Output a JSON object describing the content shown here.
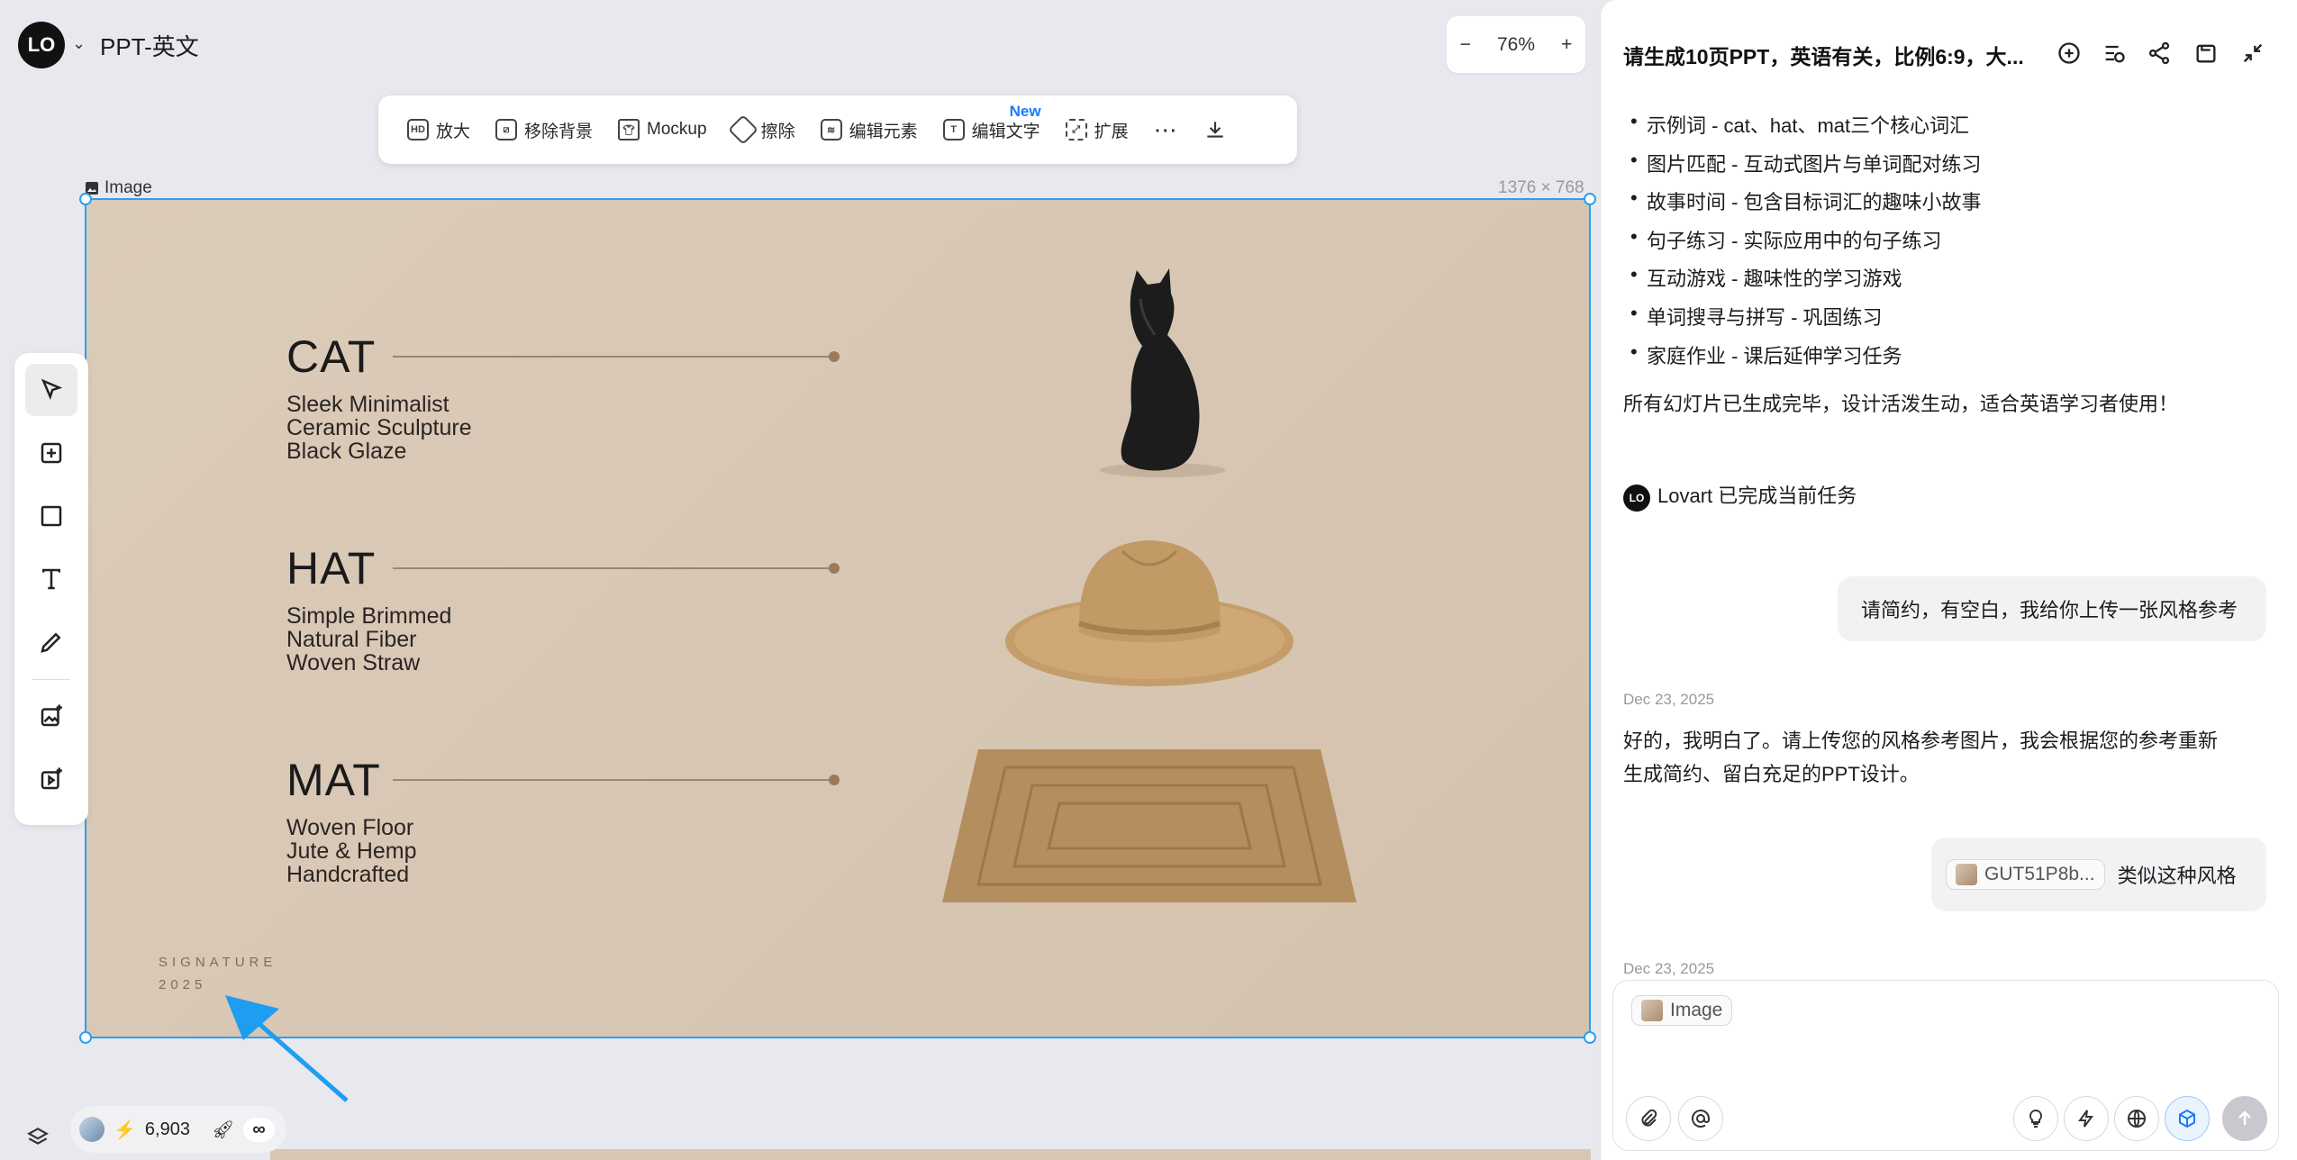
{
  "app": {
    "project_title": "PPT-英文",
    "logo_text": "LO",
    "zoom": "76%"
  },
  "toolbar": {
    "items": [
      {
        "label": "放大",
        "icon": "hd-icon"
      },
      {
        "label": "移除背景",
        "icon": "remove-bg-icon"
      },
      {
        "label": "Mockup",
        "icon": "shirt-icon"
      },
      {
        "label": "擦除",
        "icon": "eraser-icon"
      },
      {
        "label": "编辑元素",
        "icon": "layers-edit-icon"
      },
      {
        "label": "编辑文字",
        "icon": "text-edit-icon",
        "badge": "New"
      },
      {
        "label": "扩展",
        "icon": "expand-icon"
      }
    ]
  },
  "canvas": {
    "image_label": "Image",
    "image_size": "1376 × 768",
    "slide": {
      "rows": [
        {
          "word": "CAT",
          "lines": [
            "Sleek Minimalist",
            "Ceramic Sculpture",
            "Black Glaze"
          ]
        },
        {
          "word": "HAT",
          "lines": [
            "Simple Brimmed",
            "Natural Fiber",
            "Woven Straw"
          ]
        },
        {
          "word": "MAT",
          "lines": [
            "Woven Floor",
            "Jute & Hemp",
            "Handcrafted"
          ]
        }
      ],
      "signature": "SIGNATURE",
      "year": "2025"
    }
  },
  "bottom": {
    "credits": "6,903",
    "infinity": "∞"
  },
  "panel": {
    "title": "请生成10页PPT，英语有关，比例6:9，大...",
    "bullets": [
      "示例词 - cat、hat、mat三个核心词汇",
      "图片匹配 - 互动式图片与单词配对练习",
      "故事时间 - 包含目标词汇的趣味小故事",
      "句子练习 - 实际应用中的句子练习",
      "互动游戏 - 趣味性的学习游戏",
      "单词搜寻与拼写 - 巩固练习",
      "家庭作业 - 课后延伸学习任务"
    ],
    "summary": "所有幻灯片已生成完毕，设计活泼生动，适合英语学习者使用！",
    "done": "Lovart 已完成当前任务",
    "user_msg_1": "请简约，有空白，我给你上传一张风格参考",
    "date_1": "Dec 23, 2025",
    "reply_line_1": "好的，我明白了。请上传您的风格参考图片，我会根据您的参考重新",
    "reply_line_2": "生成简约、留白充足的PPT设计。",
    "attach_name": "GUT51P8b...",
    "user_msg_2": "类似这种风格",
    "date_2": "Dec 23, 2025",
    "input_chip": "Image"
  }
}
